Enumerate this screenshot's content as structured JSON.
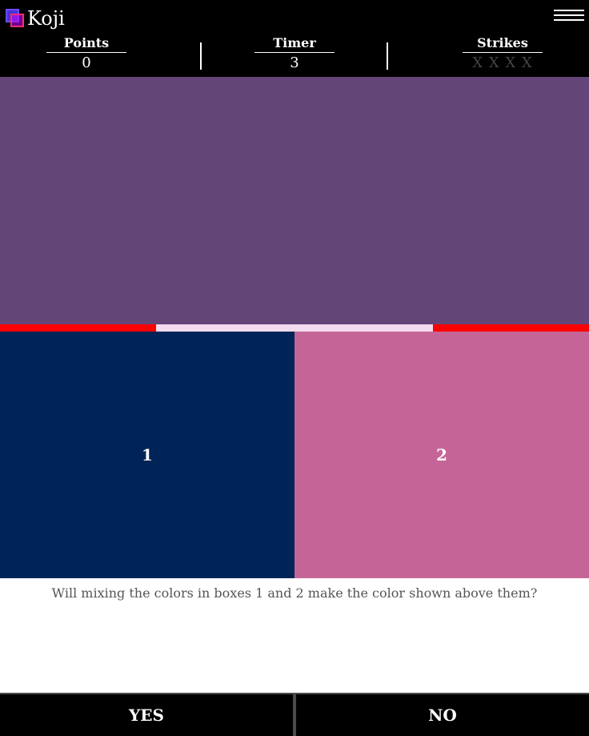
{
  "app": {
    "title": "Koji",
    "logo_icon": "koji-logo-icon",
    "menu_icon": "hamburger-menu-icon"
  },
  "stats": {
    "points": {
      "label": "Points",
      "value": "0"
    },
    "timer": {
      "label": "Timer",
      "value": "3"
    },
    "strikes": {
      "label": "Strikes",
      "value": "X X X X",
      "count": 0
    }
  },
  "game": {
    "target_color": "#644578",
    "time_remaining_fraction": 0.47,
    "timebar_color": "#ff0000",
    "timebar_remaining_color": "#f3dced",
    "boxes": [
      {
        "label": "1",
        "color": "#002457"
      },
      {
        "label": "2",
        "color": "#c56597"
      }
    ],
    "question": "Will mixing the colors in boxes 1 and 2 make the color shown above them?"
  },
  "answers": {
    "yes_label": "YES",
    "no_label": "NO"
  }
}
